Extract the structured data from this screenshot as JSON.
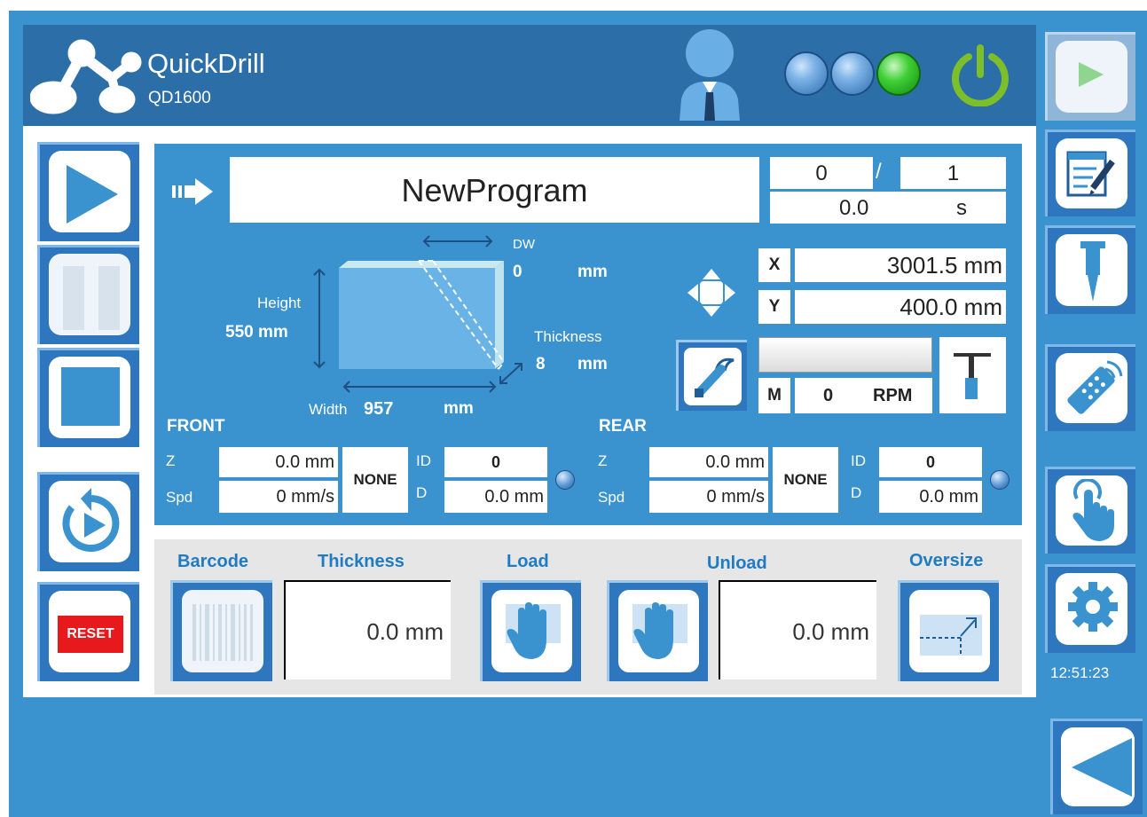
{
  "header": {
    "app_name": "QuickDrill",
    "model": "QD1600",
    "icons": {
      "logo": "molecule-logo-icon",
      "user": "user-icon",
      "power": "power-icon"
    },
    "status_lamps": [
      {
        "name": "lamp-1",
        "color": "#5b97d6"
      },
      {
        "name": "lamp-2",
        "color": "#5b97d6"
      },
      {
        "name": "lamp-3",
        "color": "#2fbf2f"
      }
    ]
  },
  "colors": {
    "frame": "#3a93cf",
    "header": "#2c6ea8",
    "accent_blue": "#1f7bc2",
    "reset_red": "#e8191d",
    "power_green": "#7cbf2a"
  },
  "left_controls": {
    "reset_label": "RESET",
    "icons": [
      "play-icon",
      "pause-icon",
      "stop-icon",
      "cycle-restart-icon",
      "reset-icon"
    ]
  },
  "program": {
    "name": "NewProgram",
    "count_current": "0",
    "separator": "/",
    "count_total": "1",
    "time_value": "0.0",
    "time_unit": "s"
  },
  "glass": {
    "dw_label": "DW",
    "dw_value": "0",
    "dw_unit": "mm",
    "height_label": "Height",
    "height_value": "550 mm",
    "thickness_label": "Thickness",
    "thickness_value": "8",
    "thickness_unit": "mm",
    "width_label": "Width",
    "width_value": "957",
    "width_unit": "mm"
  },
  "position": {
    "x_label": "X",
    "x_value": "3001.5 mm",
    "y_label": "Y",
    "y_value": "400.0 mm"
  },
  "motor": {
    "label": "M",
    "value": "0",
    "unit": "RPM"
  },
  "front": {
    "title": "FRONT",
    "z_label": "Z",
    "z_value": "0.0 mm",
    "spd_label": "Spd",
    "spd_value": "0 mm/s",
    "tool": "NONE",
    "id_label": "ID",
    "id_value": "0",
    "d_label": "D",
    "d_value": "0.0 mm"
  },
  "rear": {
    "title": "REAR",
    "z_label": "Z",
    "z_value": "0.0 mm",
    "spd_label": "Spd",
    "spd_value": "0 mm/s",
    "tool": "NONE",
    "id_label": "ID",
    "id_value": "0",
    "d_label": "D",
    "d_value": "0.0 mm"
  },
  "bottom": {
    "barcode_label": "Barcode",
    "thickness_label": "Thickness",
    "thickness_value": "0.0 mm",
    "load_label": "Load",
    "unload_label": "Unload",
    "unload_value": "0.0 mm",
    "oversize_label": "Oversize"
  },
  "right_controls": {
    "icons": [
      "run-icon",
      "edit-program-icon",
      "drill-bit-icon",
      "remote-control-icon",
      "touch-icon",
      "settings-icon",
      "back-icon"
    ],
    "clock": "12:51:23"
  }
}
